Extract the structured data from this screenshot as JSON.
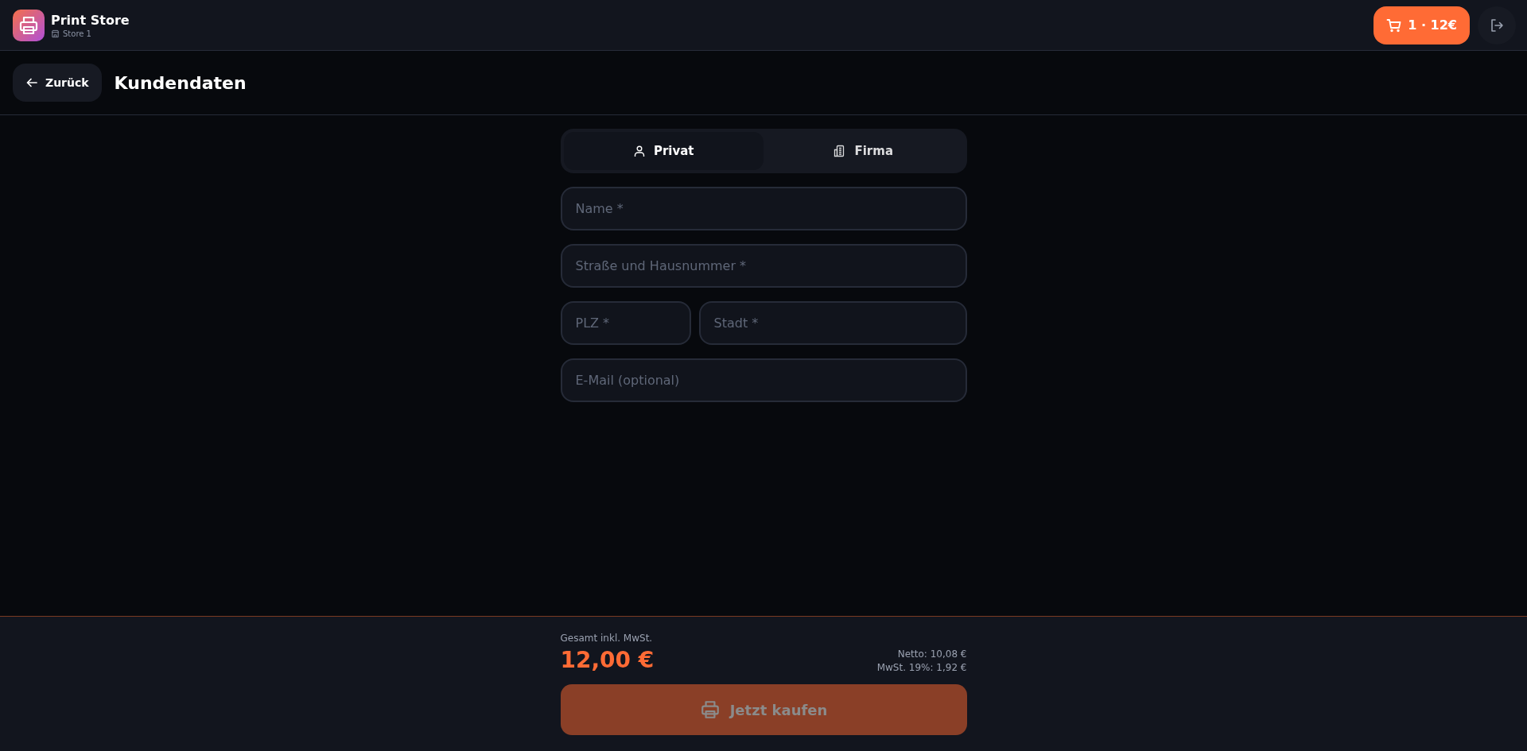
{
  "app": {
    "title": "Print Store",
    "store": "Store 1"
  },
  "cart": {
    "label": "1 · 12€"
  },
  "page": {
    "back": "Zurück",
    "title": "Kundendaten"
  },
  "tabs": [
    {
      "label": "Privat",
      "kind": "person",
      "selected": true
    },
    {
      "label": "Firma",
      "kind": "building",
      "selected": false
    }
  ],
  "fields": [
    {
      "placeholder": "Name *",
      "kind": "full"
    },
    {
      "placeholder": "Straße und Hausnummer *",
      "kind": "full"
    },
    {
      "placeholder": "PLZ *",
      "kind": "short"
    },
    {
      "placeholder": "Stadt *",
      "kind": "wide"
    },
    {
      "placeholder": "E-Mail (optional)",
      "kind": "full"
    }
  ],
  "summary": {
    "total_label": "Gesamt inkl. MwSt.",
    "total": "12,00 €",
    "net": "Netto: 10,08 €",
    "vat": "MwSt. 19%: 1,92 €"
  },
  "buy_button": {
    "label": "Jetzt kaufen",
    "disabled": true
  }
}
